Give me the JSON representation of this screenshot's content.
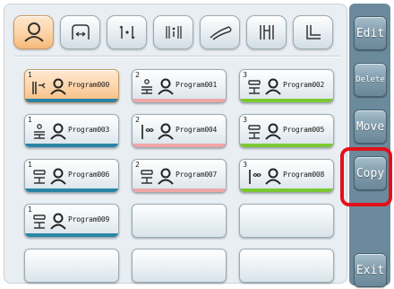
{
  "tabs": [
    {
      "icon": "person-icon",
      "active": true
    },
    {
      "icon": "frame-arrow-icon",
      "active": false
    },
    {
      "icon": "bracket-dot-icon",
      "active": false
    },
    {
      "icon": "bracket-stack-icon",
      "active": false
    },
    {
      "icon": "gripper-icon",
      "active": false
    },
    {
      "icon": "pillars-icon",
      "active": false
    },
    {
      "icon": "step-icon",
      "active": false
    }
  ],
  "programs": [
    {
      "index": "1",
      "name": "Program000",
      "tool_icon": "robot-gripper-icon",
      "stripe": "#2a84a6",
      "selected": true
    },
    {
      "index": "2",
      "name": "Program001",
      "tool_icon": "stack-plate-icon",
      "stripe": "#f0a6a6",
      "selected": false
    },
    {
      "index": "3",
      "name": "Program002",
      "tool_icon": "tower-icon",
      "stripe": "#7cc832",
      "selected": false
    },
    {
      "index": "1",
      "name": "Program003",
      "tool_icon": "stack-plate-icon",
      "stripe": "#2a84a6",
      "selected": false
    },
    {
      "index": "2",
      "name": "Program004",
      "tool_icon": "pole-infinity-icon",
      "stripe": "#f0a6a6",
      "selected": false
    },
    {
      "index": "3",
      "name": "Program005",
      "tool_icon": "tower-icon",
      "stripe": "#7cc832",
      "selected": false
    },
    {
      "index": "1",
      "name": "Program006",
      "tool_icon": "tower-icon",
      "stripe": "#2a84a6",
      "selected": false
    },
    {
      "index": "2",
      "name": "Program007",
      "tool_icon": "tower-icon",
      "stripe": "#f0a6a6",
      "selected": false
    },
    {
      "index": "3",
      "name": "Program008",
      "tool_icon": "pole-infinity-icon",
      "stripe": "#7cc832",
      "selected": false
    },
    {
      "index": "1",
      "name": "Program009",
      "tool_icon": "tower-icon",
      "stripe": "#2a84a6",
      "selected": false
    }
  ],
  "sidebar": {
    "edit": "Edit",
    "delete": "Delete",
    "move": "Move",
    "copy": "Copy",
    "exit": "Exit"
  },
  "colors": {
    "accent_selected": "#fcd3a6",
    "sidebar_bg": "#6b8a9c",
    "highlight": "#e3101a"
  }
}
